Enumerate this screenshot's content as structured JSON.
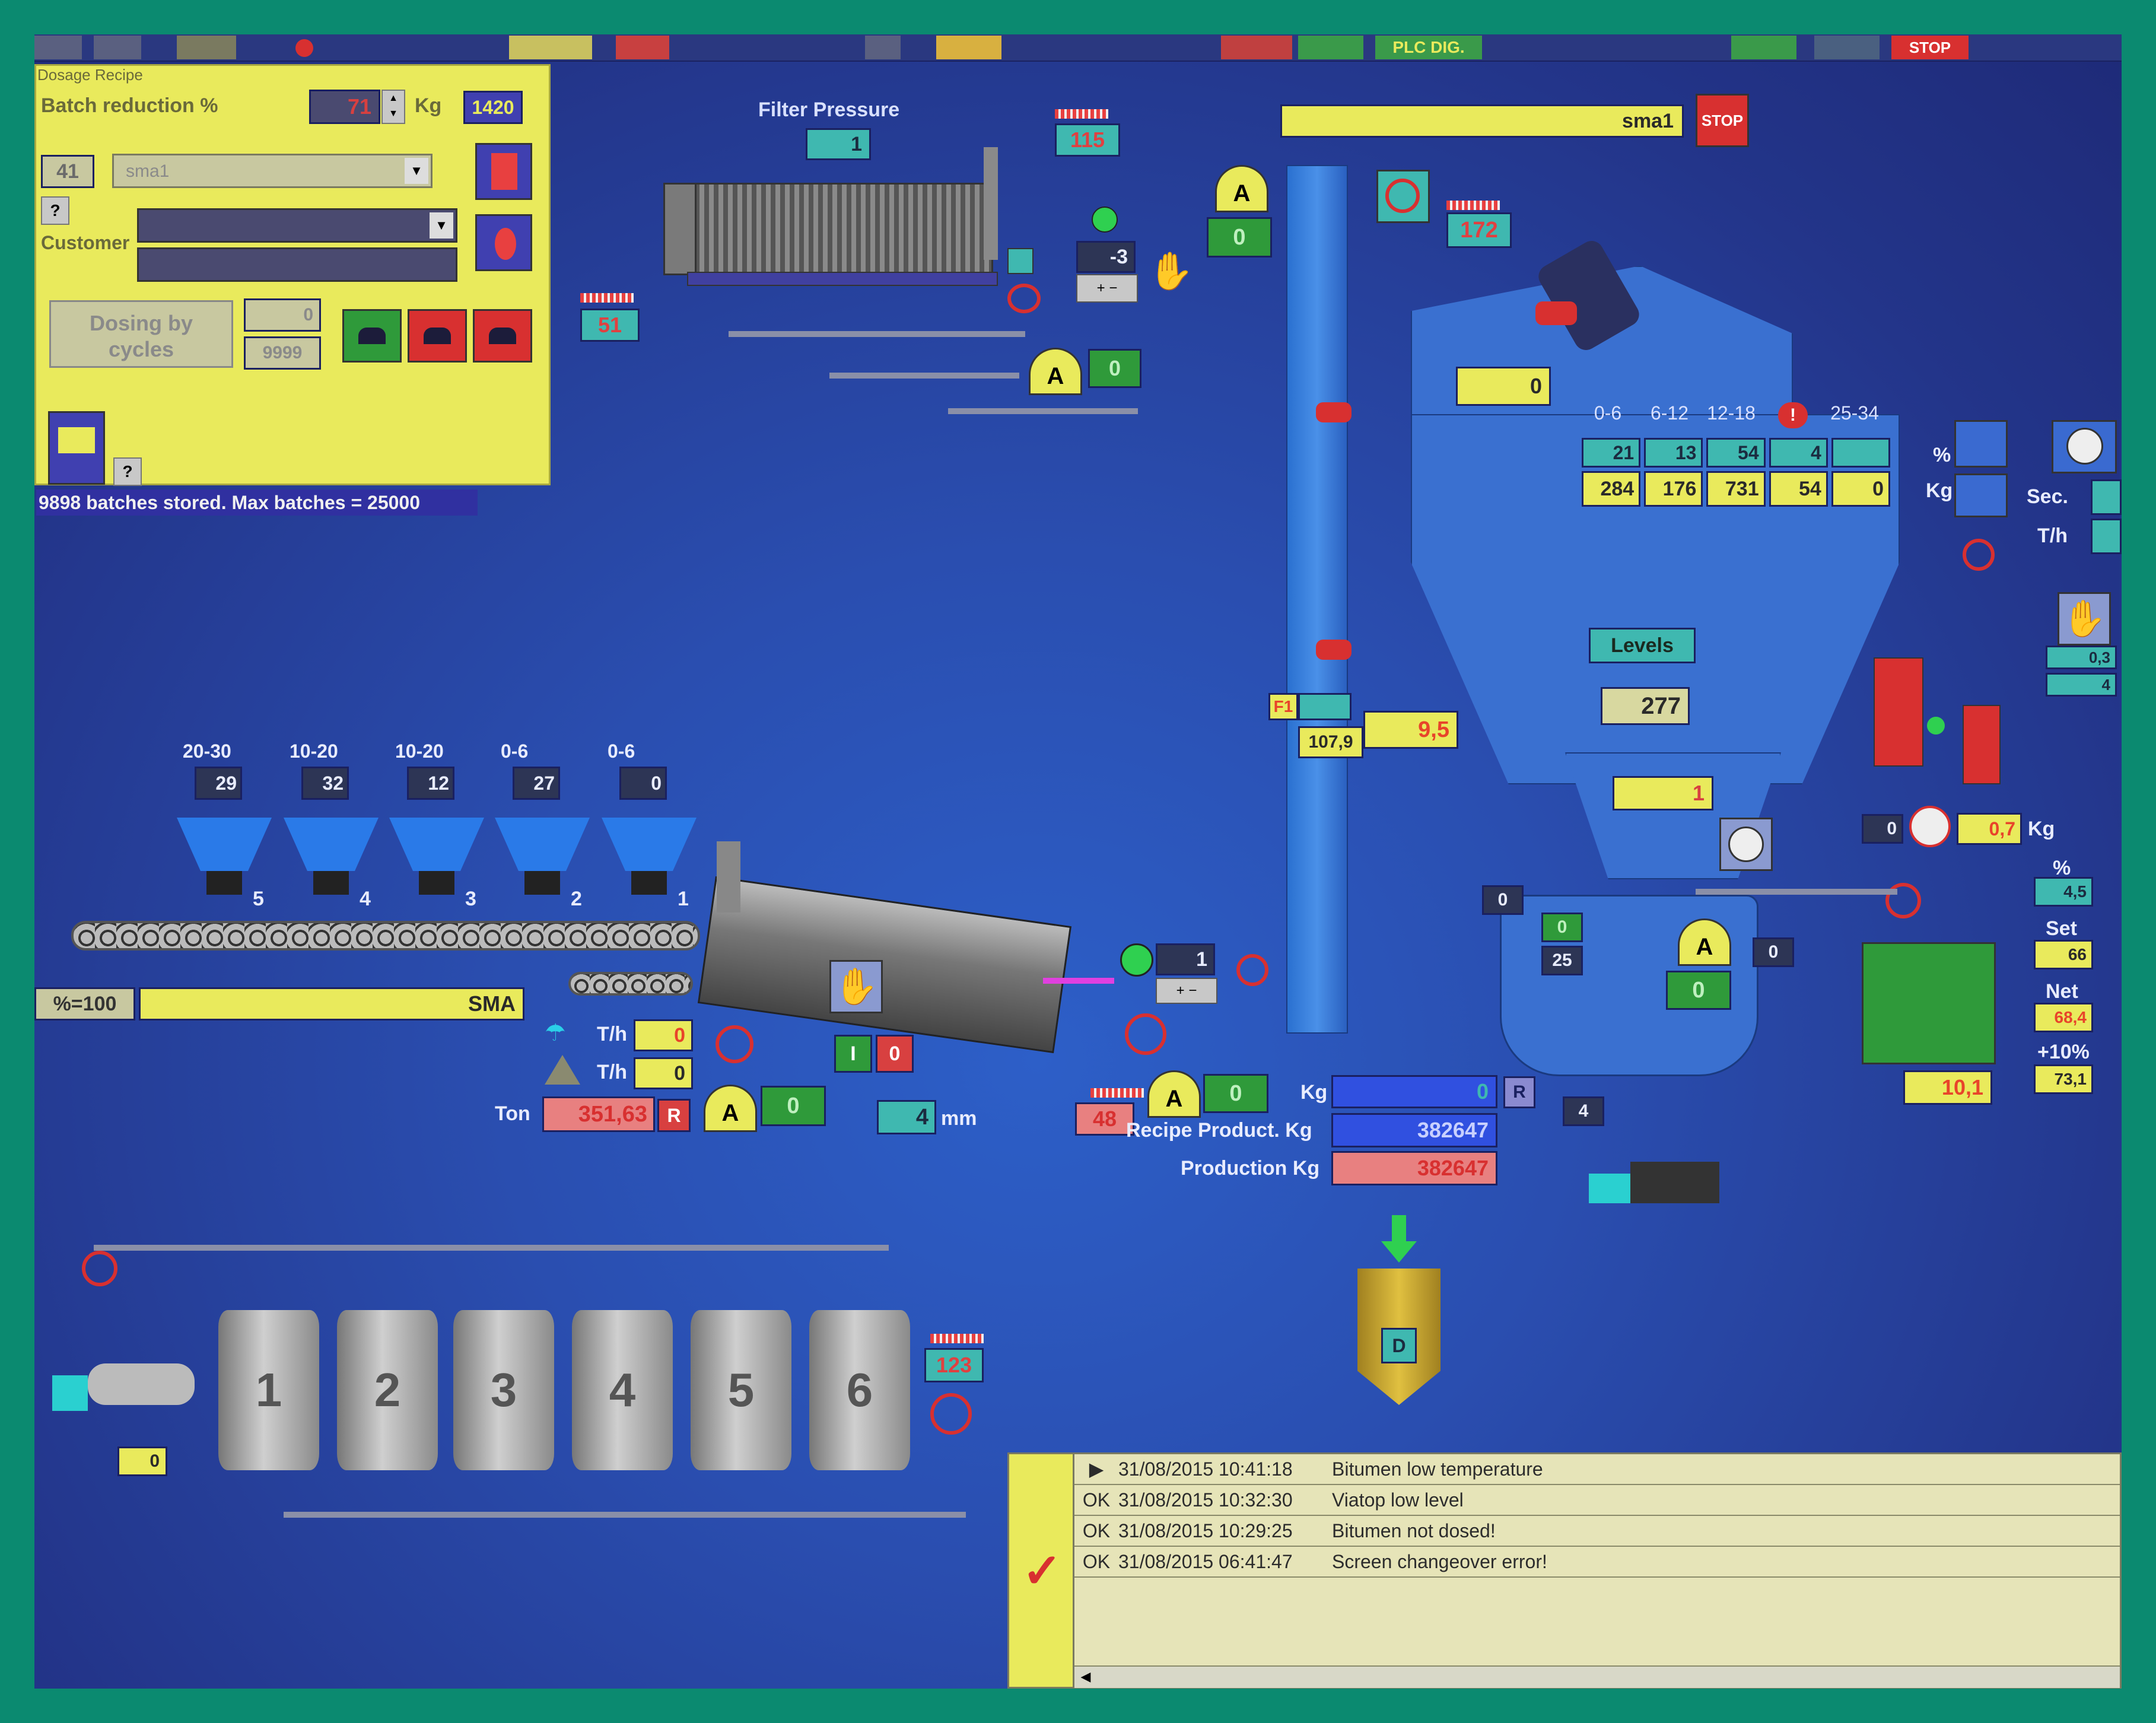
{
  "toolbar": {
    "plc_label": "PLC DIG.",
    "stop_label": "STOP"
  },
  "recipe_panel": {
    "title": "Dosage Recipe",
    "batch_reduction_label": "Batch reduction %",
    "batch_reduction_value": "71",
    "kg_label": "Kg",
    "kg_value": "1420",
    "recipe_number": "41",
    "recipe_name": "sma1",
    "help_label": "?",
    "customer_label": "Customer",
    "dosing_button": "Dosing by cycles",
    "cycles_value": "0",
    "cycles_max": "9999",
    "status_text": "9898 batches stored. Max batches = 25000"
  },
  "filter": {
    "title": "Filter Pressure",
    "pressure": "1",
    "temp_top": "115",
    "temp_left": "51",
    "fan_setpoint": "-3",
    "damper_value": "0"
  },
  "mixer_top": {
    "recipe_bar": "sma1",
    "stop_label": "STOP",
    "temp_elevator": "172",
    "gauge_value": "0",
    "flap_value": "0"
  },
  "hot_bins": {
    "headers": [
      "0-6",
      "6-12",
      "12-18",
      "!",
      "25-34"
    ],
    "pct": [
      "21",
      "13",
      "54",
      "4",
      ""
    ],
    "kg": [
      "284",
      "176",
      "731",
      "54",
      "0"
    ],
    "levels_label": "Levels",
    "levels_value": "277",
    "weigh_value": "1"
  },
  "right_panel": {
    "pct_label": "%",
    "kg_label": "Kg",
    "sec_label": "Sec.",
    "th_label": "T/h",
    "small_pct": "0,3",
    "small_kg": "4",
    "timer_value": "0",
    "kg_readout": "0,7",
    "kg_readout_unit": "Kg",
    "pct_set": "4,5",
    "set_label": "Set",
    "set_value": "66",
    "net_label": "Net",
    "net_value": "68,4",
    "tolerance_label": "+10%",
    "tolerance_value": "73,1",
    "tank_value": "10,1"
  },
  "filler": {
    "f1_label": "F1",
    "value_a": "107,9",
    "value_b": "9,5"
  },
  "cold_feed": {
    "sizes": [
      "20-30",
      "10-20",
      "10-20",
      "0-6",
      "0-6"
    ],
    "setpoints": [
      "29",
      "32",
      "12",
      "27",
      "0"
    ],
    "numbers": [
      "5",
      "4",
      "3",
      "2",
      "1"
    ],
    "pct_label": "%=100",
    "recipe_name": "SMA",
    "th_label": "T/h",
    "th_value_1": "0",
    "th_value_2": "0",
    "ton_label": "Ton",
    "ton_value": "351,63",
    "reset_label": "R",
    "gauge_value": "0",
    "mm_value": "4",
    "mm_label": "mm"
  },
  "dryer": {
    "burner_value": "1",
    "temp_value": "48",
    "gauge_value": "0",
    "on_label": "I",
    "off_label": "0"
  },
  "mixer": {
    "value_a": "0",
    "value_b": "25",
    "gauge_value": "0",
    "discharge_value": "0",
    "truck_count": "4",
    "pipe_value": "0"
  },
  "production": {
    "kg_label": "Kg",
    "kg_value": "0",
    "reset_label": "R",
    "recipe_label": "Recipe Product. Kg",
    "recipe_value": "382647",
    "prod_label": "Production Kg",
    "prod_value": "382647",
    "silo_label": "D"
  },
  "bitumen": {
    "tanks": [
      "1",
      "2",
      "3",
      "4",
      "5",
      "6"
    ],
    "temp_value": "123",
    "truck_value": "0"
  },
  "alarms": [
    {
      "status": "▶",
      "time": "31/08/2015 10:41:18",
      "message": "Bitumen low temperature"
    },
    {
      "status": "OK",
      "time": "31/08/2015 10:32:30",
      "message": "Viatop low level"
    },
    {
      "status": "OK",
      "time": "31/08/2015 10:29:25",
      "message": "Bitumen not dosed!"
    },
    {
      "status": "OK",
      "time": "31/08/2015 06:41:47",
      "message": "Screen changeover error!"
    }
  ],
  "colors": {
    "background": "#2a4eb0",
    "frame": "#0b8a70",
    "panel": "#e9ea5c",
    "accent": "#3fb8b0",
    "alarm": "#e04040"
  }
}
